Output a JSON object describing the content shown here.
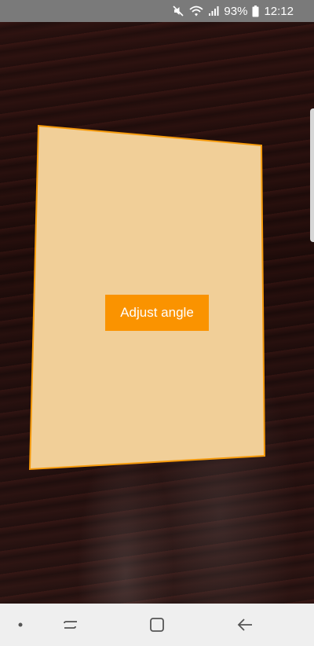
{
  "status_bar": {
    "battery_percent": "93%",
    "time": "12:12",
    "icons": [
      "mute-icon",
      "wifi-icon",
      "signal-icon",
      "battery-icon"
    ],
    "background_color": "#7a7a7a"
  },
  "camera_view": {
    "document_fill_color": "#f1cf98",
    "document_border_color": "#f59a0c"
  },
  "overlay": {
    "adjust_button_label": "Adjust angle",
    "adjust_button_color": "#fa9300"
  },
  "nav_bar": {
    "buttons": [
      "dot-icon",
      "recent-apps-icon",
      "home-icon",
      "back-icon"
    ],
    "background_color": "#efefef"
  }
}
